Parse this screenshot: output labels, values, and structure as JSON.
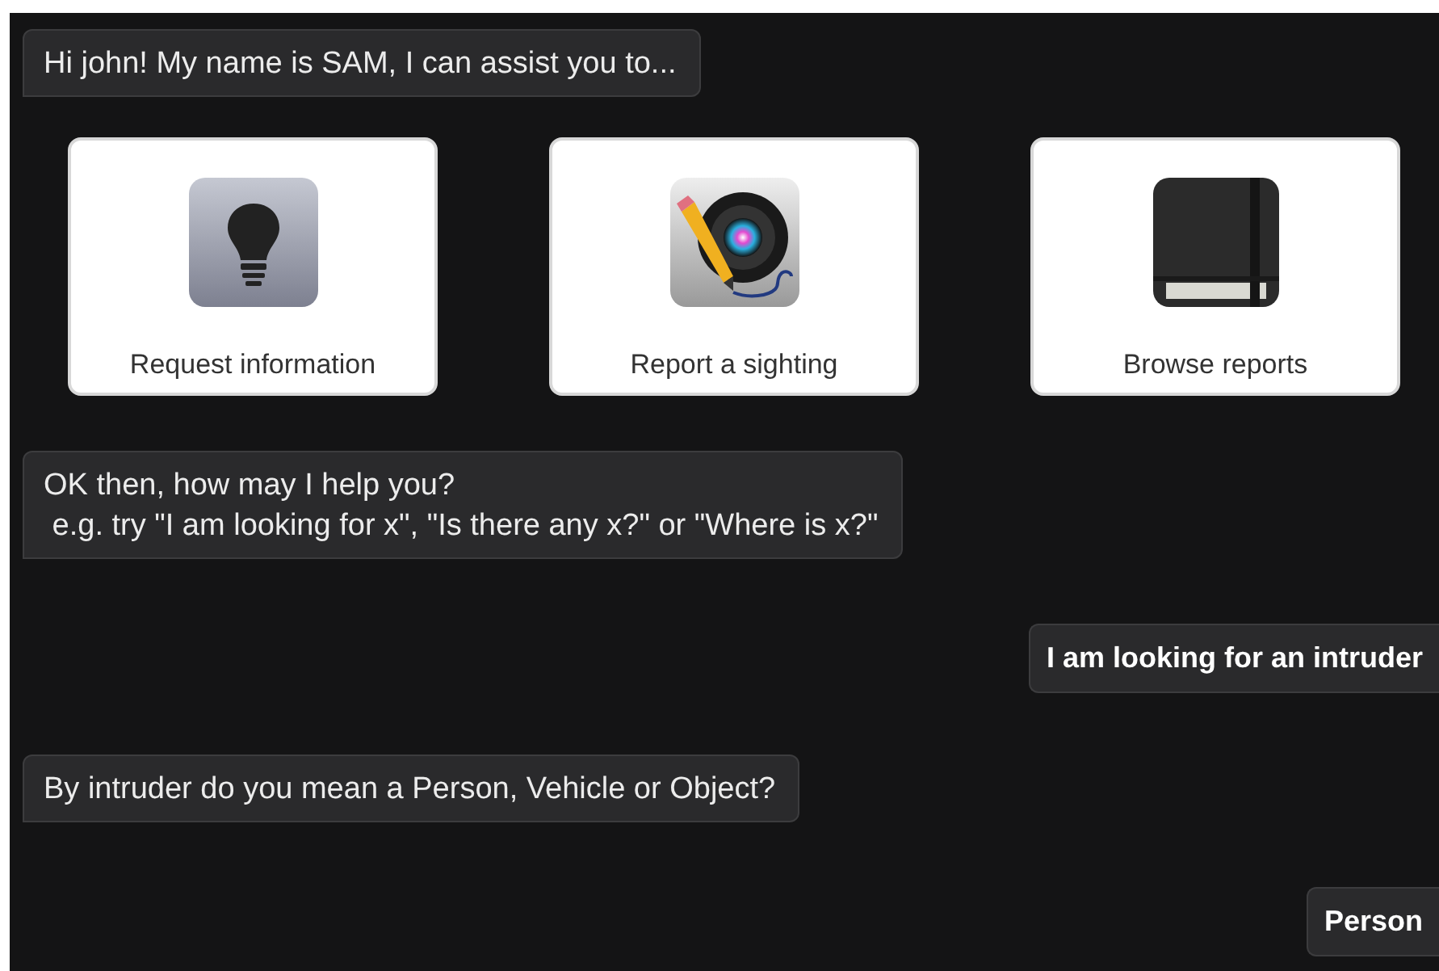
{
  "messages": [
    {
      "kind": "bot",
      "lines": [
        "Hi john! My name is SAM, I can assist you to..."
      ]
    },
    {
      "kind": "options",
      "options": [
        {
          "label": "Request information"
        },
        {
          "label": "Report a sighting"
        },
        {
          "label": "Browse reports"
        }
      ]
    },
    {
      "kind": "bot",
      "lines": [
        "OK then, how may I help you?",
        " e.g. try \"I am looking for x\", \"Is there any x?\" or \"Where is x?\""
      ]
    },
    {
      "kind": "user",
      "lines": [
        "I am looking for an intruder"
      ]
    },
    {
      "kind": "bot",
      "lines": [
        "By intruder do you mean a Person, Vehicle or Object?"
      ]
    },
    {
      "kind": "user",
      "lines": [
        "Person"
      ]
    }
  ]
}
